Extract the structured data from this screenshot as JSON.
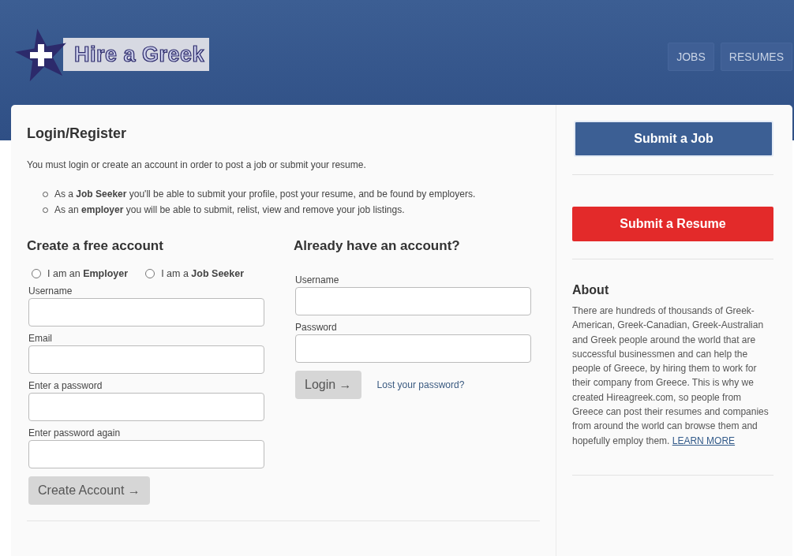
{
  "header": {
    "logo_text": "Hire a Greek",
    "nav": [
      {
        "label": "JOBS"
      },
      {
        "label": "RESUMES"
      }
    ]
  },
  "main": {
    "title": "Login/Register",
    "intro": "You must login or create an account in order to post a job or submit your resume.",
    "bullets": [
      "As a **Job Seeker** you'll be able to submit your profile, post your resume, and be found by employers.",
      "As an **employer** you will be able to submit, relist, view and remove your job listings."
    ],
    "register": {
      "title": "Create a free account",
      "roles": [
        {
          "label": "I am an **Employer**",
          "selected": false
        },
        {
          "label": "I am a **Job Seeker**",
          "selected": false
        }
      ],
      "fields": [
        {
          "label": "Username"
        },
        {
          "label": "Email"
        },
        {
          "label": "Enter a password"
        },
        {
          "label": "Enter password again"
        }
      ],
      "button": "Create Account →"
    },
    "login": {
      "title": "Already have an account?",
      "fields": [
        {
          "label": "Username"
        },
        {
          "label": "Password"
        }
      ],
      "button": "Login →",
      "link": "Lost your password?"
    }
  },
  "sidebar": {
    "buttons": [
      {
        "label": "Submit a Job",
        "kind": "job"
      },
      {
        "label": "Submit a Resume",
        "kind": "resume"
      }
    ],
    "about": {
      "title": "About",
      "text": "There are hundreds of thousands of Greek-American, Greek-Canadian, Greek-Australian and Greek people around the world that are successful businessmen and can help the people of Greece, by hiring them to work for their company from Greece. This is why we created Hireagreek.com, so people from Greece can post their resumes and companies from around the world can browse them and hopefully employ them.",
      "link": "LEARN MORE"
    }
  }
}
